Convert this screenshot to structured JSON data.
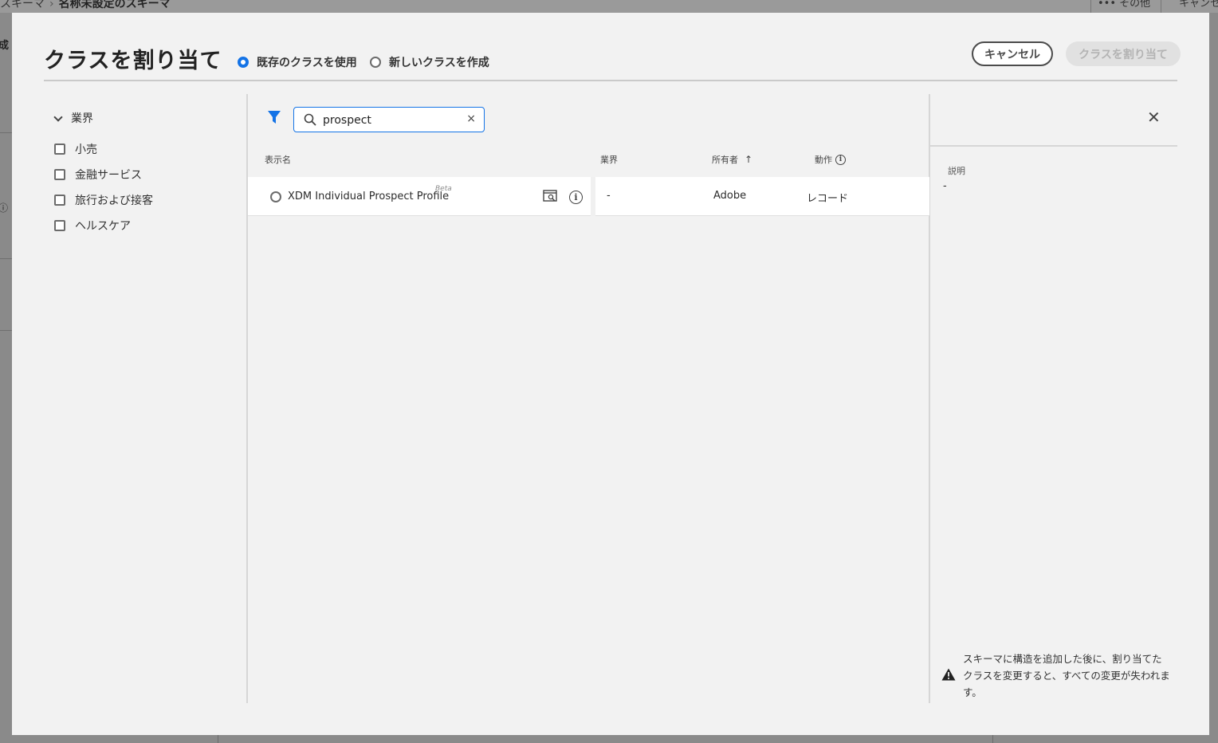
{
  "background": {
    "breadcrumb_parent": "スキーマ",
    "breadcrumb_current": "名称未設定のスキーマ",
    "more_label": "その他",
    "cancel_label": "キャンセル"
  },
  "dialog": {
    "title": "クラスを割り当て",
    "options": [
      {
        "label": "既存のクラスを使用",
        "selected": true
      },
      {
        "label": "新しいクラスを作成",
        "selected": false
      }
    ],
    "cancel_button": "キャンセル",
    "assign_button": "クラスを割り当て"
  },
  "filters": {
    "heading": "業界",
    "items": [
      "小売",
      "金融サービス",
      "旅行および接客",
      "ヘルスケア"
    ]
  },
  "search": {
    "value": "prospect",
    "clear_glyph": "×"
  },
  "table": {
    "headers": {
      "display_name": "表示名",
      "industry": "業界",
      "owner": "所有者",
      "behavior": "動作"
    },
    "sort": {
      "column": "owner",
      "direction": "ascending"
    },
    "rows": [
      {
        "name": "XDM Individual Prospect Profile",
        "badge": "Beta",
        "industry": "-",
        "owner": "Adobe",
        "behavior": "レコード"
      }
    ]
  },
  "details": {
    "description_label": "説明",
    "description_value": "-",
    "warning": "スキーマに構造を追加した後に、割り当てたクラスを変更すると、すべての変更が失われます。"
  },
  "colors": {
    "accent": "#1473e6",
    "dialog_bg": "#f2f2f2",
    "overlay": "#7c7c7c"
  },
  "icons": [
    "chevron-down-icon",
    "filter-icon",
    "search-icon",
    "clear-icon",
    "preview-icon",
    "info-icon",
    "sort-ascending-icon",
    "close-icon",
    "warning-icon",
    "more-icon",
    "chevron-right-icon"
  ]
}
